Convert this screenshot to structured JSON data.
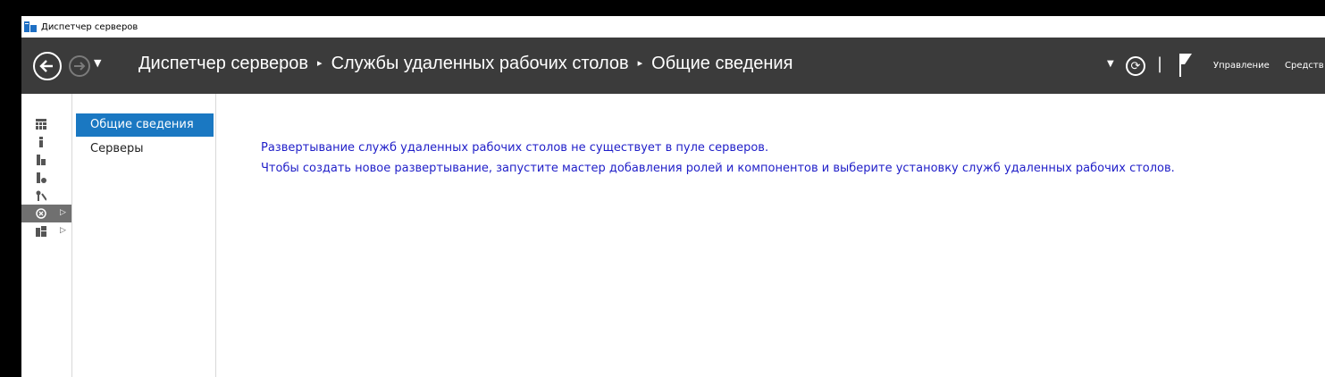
{
  "window": {
    "title": "Диспетчер серверов"
  },
  "header": {
    "breadcrumb": [
      "Диспетчер серверов",
      "Службы удаленных рабочих столов",
      "Общие сведения"
    ],
    "menu": [
      "Управление",
      "Средств"
    ]
  },
  "sidebar": {
    "icons": [
      {
        "name": "dashboard-icon"
      },
      {
        "name": "local-server-icon"
      },
      {
        "name": "all-servers-icon"
      },
      {
        "name": "ad-certificate-services-icon"
      },
      {
        "name": "ad-domain-services-icon"
      },
      {
        "name": "remote-desktop-services-icon",
        "active": true,
        "expandable": true
      },
      {
        "name": "file-storage-services-icon",
        "expandable": true
      }
    ]
  },
  "panel": {
    "items": [
      "Общие сведения",
      "Серверы"
    ],
    "selected_index": 0
  },
  "main": {
    "messages": [
      "Развертывание служб удаленных рабочих столов не существует в пуле серверов.",
      "Чтобы создать новое развертывание, запустите мастер добавления ролей и компонентов и выберите установку служб удаленных рабочих столов."
    ]
  },
  "colors": {
    "header_bg": "#3b3b3b",
    "selection": "#1a78c2",
    "message_text": "#1f1ec8",
    "active_icon_bg": "#707070"
  }
}
